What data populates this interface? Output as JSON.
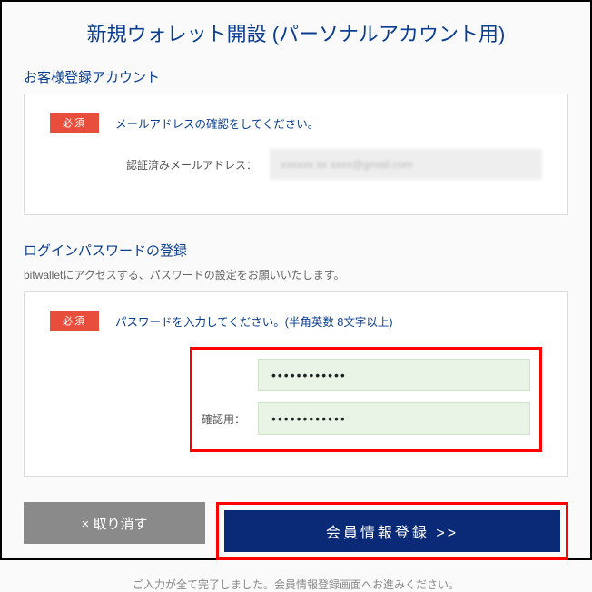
{
  "title": "新規ウォレット開設 (パーソナルアカウント用)",
  "section1": {
    "heading": "お客様登録アカウント",
    "required_badge": "必須",
    "instruction": "メールアドレスの確認をしてください。",
    "email_label": "認証済みメールアドレス：",
    "email_value": "xxxxxx xx xxxx@gmail.com"
  },
  "section2": {
    "heading": "ログインパスワードの登録",
    "sub": "bitwalletにアクセスする、パスワードの設定をお願いいたします。",
    "required_badge": "必須",
    "instruction": "パスワードを入力してください。(半角英数 8文字以上)",
    "confirm_label": "確認用：",
    "pw_value": "••••••••••••",
    "pw_confirm_value": "••••••••••••"
  },
  "buttons": {
    "cancel": "× 取り消す",
    "submit": "会員情報登録 >>"
  },
  "footer": "ご入力が全て完了しました。会員情報登録画面へお進みください。"
}
